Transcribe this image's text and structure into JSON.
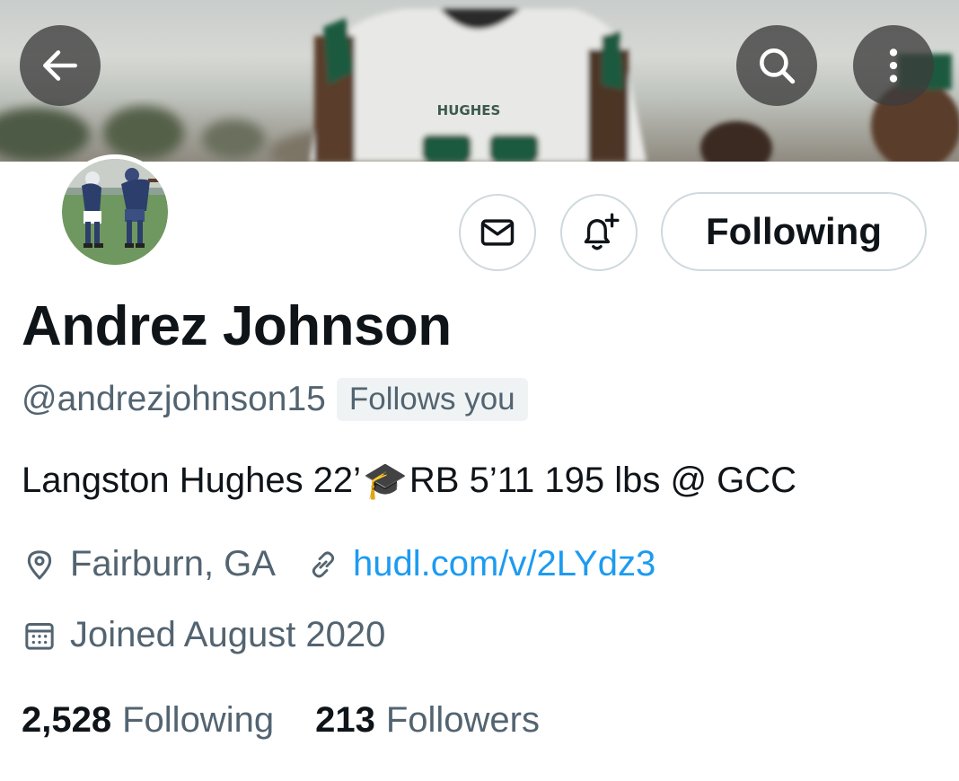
{
  "header": {
    "back_icon": "arrow-left-icon",
    "search_icon": "search-icon",
    "more_icon": "more-vertical-icon",
    "banner_jersey_text": "HUGHES"
  },
  "profile": {
    "display_name": "Andrez Johnson",
    "handle": "@andrezjohnson15",
    "follows_you": "Follows you",
    "bio_part1": "Langston Hughes 22’",
    "bio_emoji": "🎓",
    "bio_part2": "RB 5’11 195 lbs @ GCC",
    "location": "Fairburn, GA",
    "website": "hudl.com/v/2LYdz3",
    "joined": "Joined August 2020"
  },
  "actions": {
    "message_icon": "envelope-icon",
    "notify_icon": "bell-plus-icon",
    "following_label": "Following"
  },
  "stats": {
    "following_count": "2,528",
    "following_label": "Following",
    "followers_count": "213",
    "followers_label": "Followers"
  },
  "colors": {
    "text_primary": "#0f1419",
    "text_secondary": "#536471",
    "link": "#1d9bf0",
    "border": "#cfd9de",
    "badge_bg": "#eff3f4"
  }
}
